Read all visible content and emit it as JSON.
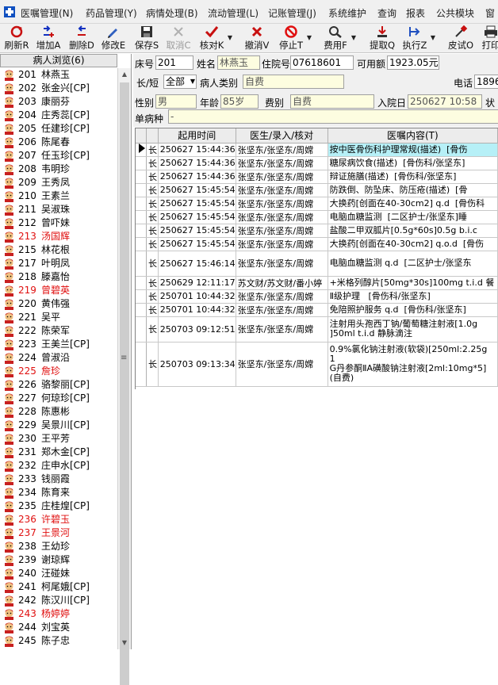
{
  "menu": [
    "医嘱管理(N)",
    "药品管理(Y)",
    "病情处理(B)",
    "流动管理(L)",
    "记账管理(J)",
    "系统维护",
    "查询",
    "报表",
    "公共模块",
    "窗"
  ],
  "toolbar": [
    {
      "label": "刷新R",
      "icon": "refresh-icon",
      "color": "#c81010",
      "disabled": false
    },
    {
      "label": "增加A",
      "icon": "add-icon",
      "color": "#1030c0",
      "disabled": false
    },
    {
      "label": "删除D",
      "icon": "delete-icon",
      "color": "#1030c0",
      "disabled": false
    },
    {
      "label": "修改E",
      "icon": "edit-icon",
      "color": "#3060c0",
      "disabled": false
    },
    {
      "label": "保存S",
      "icon": "save-icon",
      "color": "#303030",
      "disabled": false
    },
    {
      "label": "取消C",
      "icon": "cancel-icon",
      "color": "#a0a0a0",
      "disabled": true
    },
    {
      "label": "核对K",
      "icon": "check-icon",
      "color": "#c81010",
      "disabled": false,
      "dropdown": true
    },
    {
      "label": "撤消V",
      "icon": "undo-icon",
      "color": "#c81010",
      "disabled": false
    },
    {
      "label": "停止T",
      "icon": "stop-icon",
      "color": "#e01010",
      "disabled": false,
      "dropdown": true
    },
    {
      "label": "费用F",
      "icon": "fee-icon",
      "color": "#303030",
      "disabled": false,
      "dropdown": true
    },
    {
      "label": "提取Q",
      "icon": "extract-icon",
      "color": "#c81010",
      "disabled": false
    },
    {
      "label": "执行Z",
      "icon": "execute-icon",
      "color": "#2050c0",
      "disabled": false,
      "dropdown": true
    },
    {
      "label": "皮试O",
      "icon": "skin-test-icon",
      "color": "#303030",
      "disabled": false
    },
    {
      "label": "打印",
      "icon": "print-icon",
      "color": "#303030",
      "disabled": false
    }
  ],
  "sidebar": {
    "title": "病人浏览(6)",
    "patients": [
      {
        "bed": "201",
        "name": "林燕玉",
        "red": false
      },
      {
        "bed": "202",
        "name": "张金兴[CP]",
        "red": false
      },
      {
        "bed": "203",
        "name": "康丽芬",
        "red": false
      },
      {
        "bed": "204",
        "name": "庄秀蕊[CP]",
        "red": false
      },
      {
        "bed": "205",
        "name": "任建珍[CP]",
        "red": false
      },
      {
        "bed": "206",
        "name": "陈尾春",
        "red": false
      },
      {
        "bed": "207",
        "name": "任玉珍[CP]",
        "red": false
      },
      {
        "bed": "208",
        "name": "韦明珍",
        "red": false
      },
      {
        "bed": "209",
        "name": "王秀凤",
        "red": false
      },
      {
        "bed": "210",
        "name": "王素兰",
        "red": false
      },
      {
        "bed": "211",
        "name": "吴淑珠",
        "red": false
      },
      {
        "bed": "212",
        "name": "曾吓妹",
        "red": false
      },
      {
        "bed": "213",
        "name": "汤国辉",
        "red": true
      },
      {
        "bed": "215",
        "name": "林花根",
        "red": false
      },
      {
        "bed": "217",
        "name": "叶明凤",
        "red": false
      },
      {
        "bed": "218",
        "name": "滕嘉怡",
        "red": false
      },
      {
        "bed": "219",
        "name": "曾碧英",
        "red": true
      },
      {
        "bed": "220",
        "name": "黄伟强",
        "red": false
      },
      {
        "bed": "221",
        "name": "吴平",
        "red": false
      },
      {
        "bed": "222",
        "name": "陈荣军",
        "red": false
      },
      {
        "bed": "223",
        "name": "王美兰[CP]",
        "red": false
      },
      {
        "bed": "224",
        "name": "曾淑沿",
        "red": false
      },
      {
        "bed": "225",
        "name": "詹珍",
        "red": true
      },
      {
        "bed": "226",
        "name": "骆黎丽[CP]",
        "red": false
      },
      {
        "bed": "227",
        "name": "何琼珍[CP]",
        "red": false
      },
      {
        "bed": "228",
        "name": "陈惠彬",
        "red": false
      },
      {
        "bed": "229",
        "name": "吴景川[CP]",
        "red": false
      },
      {
        "bed": "230",
        "name": "王平芳",
        "red": false
      },
      {
        "bed": "231",
        "name": "郑木金[CP]",
        "red": false
      },
      {
        "bed": "232",
        "name": "庄申水[CP]",
        "red": false
      },
      {
        "bed": "233",
        "name": "钱丽霞",
        "red": false
      },
      {
        "bed": "234",
        "name": "陈育来",
        "red": false
      },
      {
        "bed": "235",
        "name": "庄桂煌[CP]",
        "red": false
      },
      {
        "bed": "236",
        "name": "许碧玉",
        "red": true
      },
      {
        "bed": "237",
        "name": "王景河",
        "red": true
      },
      {
        "bed": "238",
        "name": "王幼珍",
        "red": false
      },
      {
        "bed": "239",
        "name": "谢琼辉",
        "red": false
      },
      {
        "bed": "240",
        "name": "汪碰妹",
        "red": false
      },
      {
        "bed": "241",
        "name": "柯尾娥[CP]",
        "red": false
      },
      {
        "bed": "242",
        "name": "陈汉川[CP]",
        "red": false
      },
      {
        "bed": "243",
        "name": "杨婷婷",
        "red": true
      },
      {
        "bed": "244",
        "name": "刘宝英",
        "red": false
      },
      {
        "bed": "245",
        "name": "陈子忠",
        "red": false
      }
    ]
  },
  "patient_info": {
    "bed_label": "床号",
    "bed_value": "201",
    "name_label": "姓名",
    "name_value": "林燕玉",
    "admission_no_label": "住院号",
    "admission_no_value": "07618601",
    "available_label": "可用额",
    "available_value": "1923.05元",
    "order_type_label": "长/短",
    "order_type_value": "全部",
    "patient_category_label": "病人类别",
    "patient_category_value": "自费",
    "phone_label": "电话",
    "phone_value": "1896",
    "sex_label": "性别",
    "sex_value": "男",
    "age_label": "年龄",
    "age_value": "85岁",
    "fee_category_label": "费别",
    "fee_category_value": "自费",
    "admit_date_label": "入院日",
    "admit_date_value": "250627 10:58",
    "status_label": "状",
    "disease_label": "单病种",
    "disease_value": "-"
  },
  "orders": {
    "headers": [
      "起用时间",
      "医生/录入/核对",
      "医嘱内容(T)"
    ],
    "rows": [
      {
        "type": "长",
        "time": "250627 15:44:36",
        "doctor": "张坚东/张坚东/周嫦",
        "content": "按中医骨伤科护理常规(描述)  [骨伤",
        "selected": true
      },
      {
        "type": "长",
        "time": "250627 15:44:36",
        "doctor": "张坚东/张坚东/周嫦",
        "content": "糖尿病饮食(描述)  [骨伤科/张坚东]"
      },
      {
        "type": "长",
        "time": "250627 15:44:36",
        "doctor": "张坚东/张坚东/周嫦",
        "content": "辩证施膳(描述)  [骨伤科/张坚东]"
      },
      {
        "type": "长",
        "time": "250627 15:45:54",
        "doctor": "张坚东/张坚东/周嫦",
        "content": "防跌倒、防坠床、防压疮(描述)  [骨"
      },
      {
        "type": "长",
        "time": "250627 15:45:54",
        "doctor": "张坚东/张坚东/周嫦",
        "content": "大换药[创面在40-30cm2] q.d  [骨伤科"
      },
      {
        "type": "长",
        "time": "250627 15:45:54",
        "doctor": "张坚东/张坚东/周嫦",
        "content": "电脑血糖监测  [二区护士/张坚东]睡"
      },
      {
        "type": "长",
        "time": "250627 15:45:54",
        "doctor": "张坚东/张坚东/周嫦",
        "content": "盐酸二甲双胍片[0.5g*60s]0.5g b.i.c"
      },
      {
        "type": "长",
        "time": "250627 15:45:54",
        "doctor": "张坚东/张坚东/周嫦",
        "content": "大换药[创面在40-30cm2] q.o.d  [骨伤"
      },
      {
        "type": "长",
        "time": "250627 15:46:14",
        "doctor": "张坚东/张坚东/周嫦",
        "content": "电脑血糖监测 q.d  [二区护士/张坚东",
        "tall": true
      },
      {
        "type": "长",
        "time": "250629 12:11:17",
        "doctor": "苏文财/苏文财/番小婷",
        "content": "+米格列醇片[50mg*30s]100mg t.i.d 餐"
      },
      {
        "type": "长",
        "time": "250701 10:44:32",
        "doctor": "张坚东/张坚东/周嫦",
        "content": "Ⅱ级护理   [骨伤科/张坚东]"
      },
      {
        "type": "长",
        "time": "250701 10:44:32",
        "doctor": "张坚东/张坚东/周嫦",
        "content": "免陪照护服务 q.d  [骨伤科/张坚东]"
      },
      {
        "type": "长",
        "time": "250703 09:12:51",
        "doctor": "张坚东/张坚东/周嫦",
        "content": "注射用头孢西丁钠/葡萄糖注射液[1.0g\n]50ml t.i.d 静脉滴注",
        "tall": true
      },
      {
        "type": "长",
        "time": "250703 09:13:34",
        "doctor": "张坚东/张坚东/周嫦",
        "content": "0.9%氯化钠注射液(软袋)[250ml:2.25g\n1\nG丹参酮ⅡA磺酸钠注射液[2ml:10mg*5]\n(自费)",
        "xtall": true
      }
    ]
  }
}
